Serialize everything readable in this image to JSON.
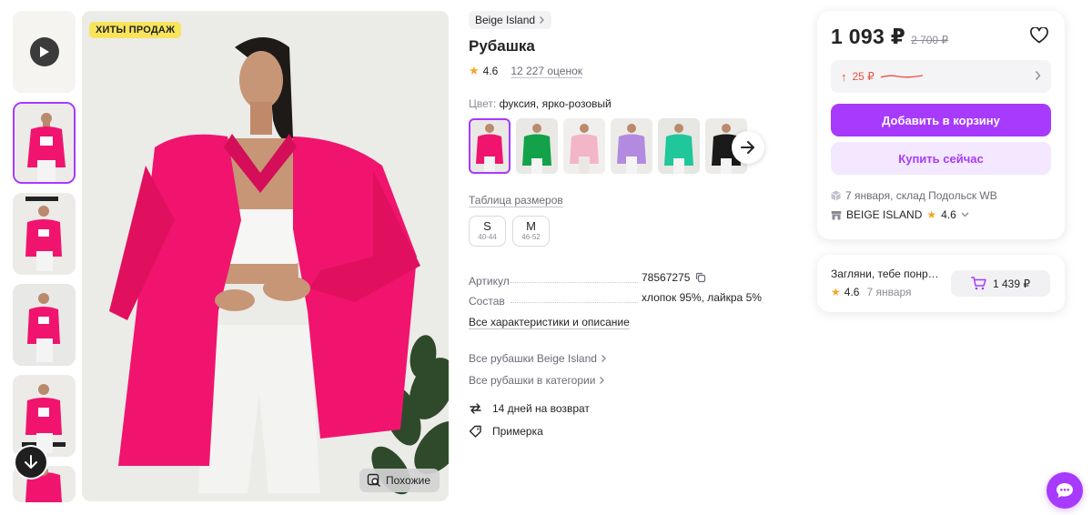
{
  "gallery": {
    "badge": "ХИТЫ ПРОДАЖ",
    "similar_label": "Похожие",
    "thumbnail_count": 5
  },
  "product": {
    "brand": "Beige Island",
    "title": "Рубашка",
    "rating": "4.6",
    "reviews": "12 227 оценок",
    "color_label": "Цвет:",
    "color_value": "фуксия, ярко-розовый",
    "size_table_label": "Таблица размеров",
    "sizes": [
      {
        "size": "S",
        "range": "40-44"
      },
      {
        "size": "M",
        "range": "46-52"
      }
    ],
    "specs": [
      {
        "key": "Артикул",
        "value": "78567275"
      },
      {
        "key": "Состав",
        "value": "хлопок 95%, лайкра 5%"
      }
    ],
    "all_specs_link": "Все характеристики и описание",
    "category_links": [
      "Все рубашки Beige Island",
      "Все рубашки в категории"
    ],
    "features": [
      "14 дней на возврат",
      "Примерка"
    ]
  },
  "price_card": {
    "price": "1 093 ₽",
    "old_price": "2 700 ₽",
    "wallet_change": "25 ₽",
    "add_to_cart": "Добавить в корзину",
    "buy_now": "Купить сейчас",
    "delivery": "7 января, склад Подольск WB",
    "seller": "BEIGE ISLAND",
    "seller_rating": "4.6"
  },
  "promo_card": {
    "title": "Загляни, тебе понрав...",
    "rating": "4.6",
    "date": "7 января",
    "price": "1 439 ₽"
  },
  "colors": {
    "accent": "#a73afd",
    "accent_light": "#f3e8ff",
    "badge_yellow": "#f8e45c",
    "star": "#f5a623",
    "price_up": "#f04e3e",
    "shirt_fuchsia": "#f0146e"
  }
}
